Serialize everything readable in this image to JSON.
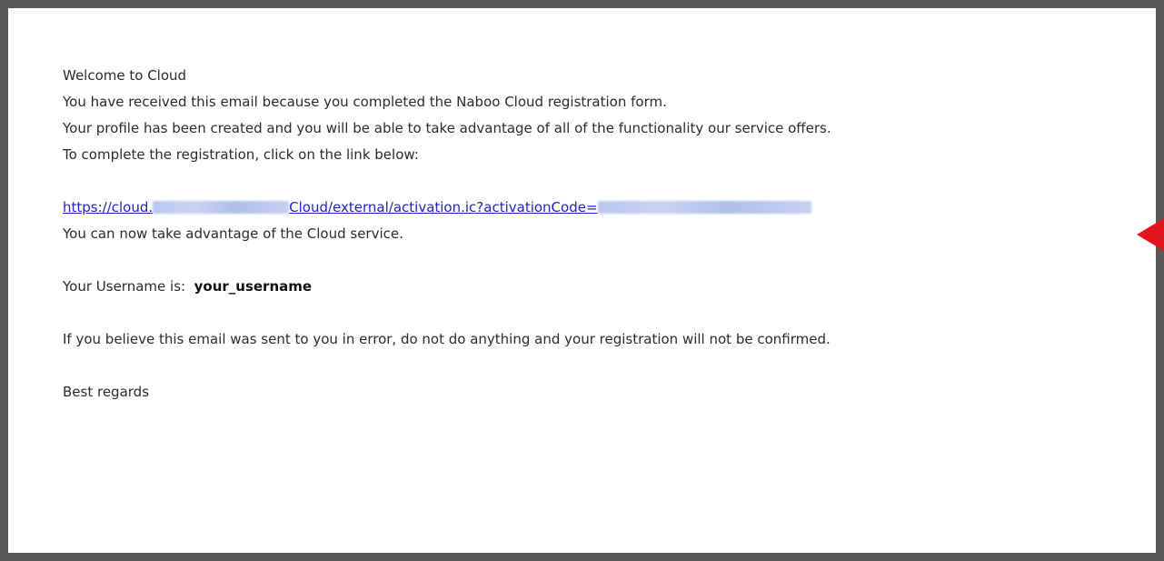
{
  "email": {
    "greeting": "Welcome to Cloud",
    "line_received": "You have received this email because you completed the Naboo Cloud registration form.",
    "line_profile": "Your profile has been created and you will be able to take advantage of all of the functionality our service offers.",
    "line_instruction": "To complete the registration, click on the link below:",
    "activation_link": {
      "part1": "https://cloud.",
      "part2": "Cloud/external/activation.ic?activationCode="
    },
    "line_service": "You can now take advantage of the Cloud service.",
    "username_label": "Your Username is:",
    "username_value": "your_username",
    "line_error": "If you believe this email was sent to you in error, do not do anything and your registration will not be confirmed.",
    "signoff": "Best regards"
  },
  "colors": {
    "link": "#2222cc",
    "pointer": "#e3141b",
    "frame": "#595959"
  }
}
